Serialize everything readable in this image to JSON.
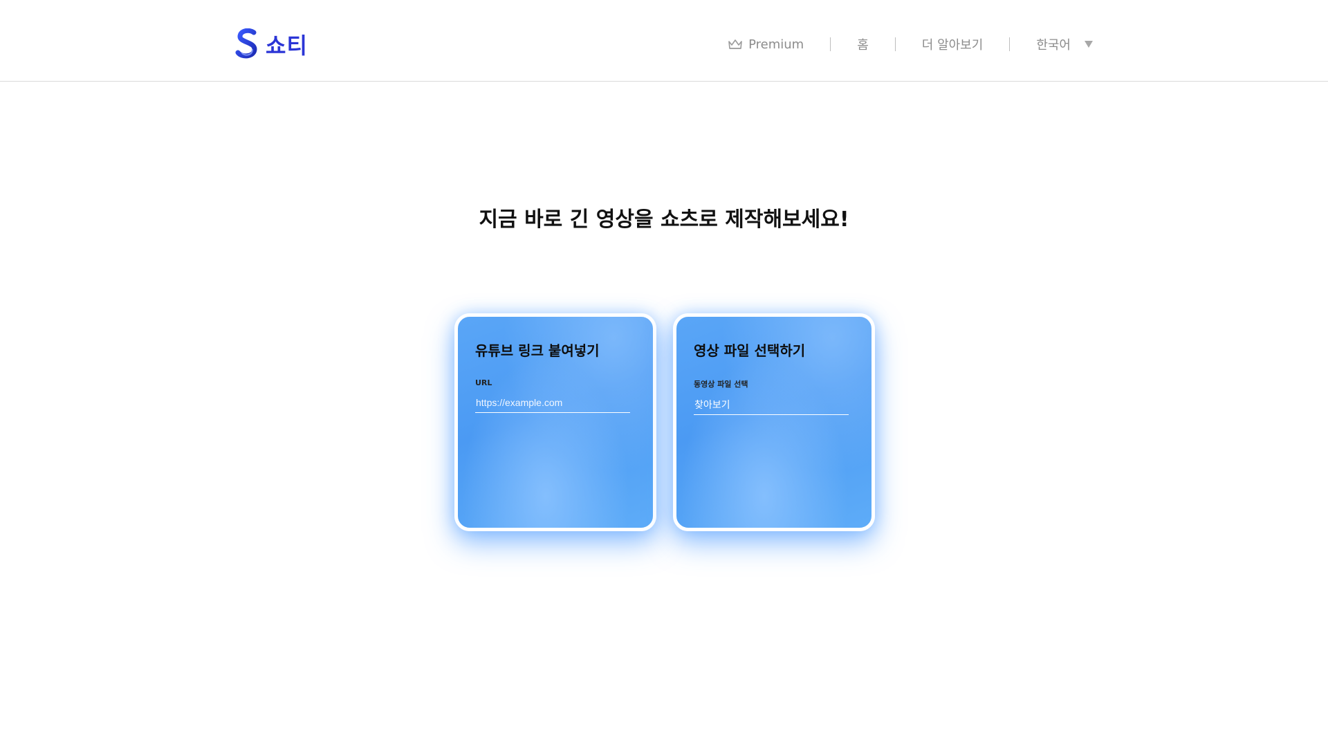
{
  "header": {
    "brand": "쇼티",
    "nav": [
      {
        "label": "Premium",
        "icon": "crown-icon"
      },
      {
        "label": "홈"
      },
      {
        "label": "더 알아보기"
      },
      {
        "label": "한국어",
        "icon": "caret-down-icon"
      }
    ]
  },
  "main": {
    "headline": "지금 바로 긴 영상을 쇼츠로 제작해보세요!",
    "cards": [
      {
        "title": "유튜브 링크 붙여넣기",
        "field_label": "URL",
        "placeholder": "https://example.com"
      },
      {
        "title": "영상 파일 선택하기",
        "field_label": "동영상 파일 선택",
        "button_label": "찾아보기"
      }
    ]
  },
  "colors": {
    "brand": "#2b35d6",
    "card_blue": "#4b9af3",
    "nav_text": "#8c8c8c"
  }
}
